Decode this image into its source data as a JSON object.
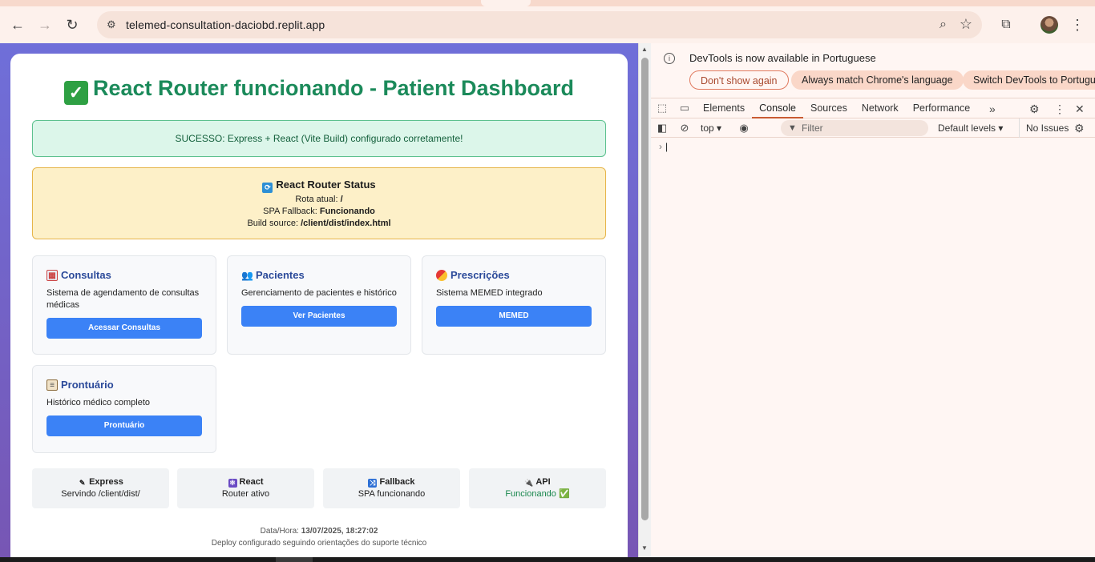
{
  "browser": {
    "url": "telemed-consultation-daciobd.replit.app"
  },
  "page": {
    "title": "React Router funcionando - Patient Dashboard",
    "success_message": "SUCESSO: Express + React (Vite Build) configurado corretamente!",
    "status": {
      "title": "React Router Status",
      "route_label": "Rota atual:",
      "route_value": "/",
      "fallback_label": "SPA Fallback:",
      "fallback_value": "Funcionando",
      "build_label": "Build source:",
      "build_value": "/client/dist/index.html"
    },
    "features": [
      {
        "title": "Consultas",
        "icon": "calendar-icon",
        "desc": "Sistema de agendamento de consultas médicas",
        "button": "Acessar Consultas"
      },
      {
        "title": "Pacientes",
        "icon": "people-icon",
        "desc": "Gerenciamento de pacientes e histórico",
        "button": "Ver Pacientes"
      },
      {
        "title": "Prescrições",
        "icon": "pill-icon",
        "desc": "Sistema MEMED integrado",
        "button": "MEMED"
      },
      {
        "title": "Prontuário",
        "icon": "clipboard-icon",
        "desc": "Histórico médico completo",
        "button": "Prontuário"
      }
    ],
    "tech": [
      {
        "title": "Express",
        "icon": "pencil-icon",
        "value": "Servindo /client/dist/"
      },
      {
        "title": "React",
        "icon": "atom-icon",
        "value": "Router ativo"
      },
      {
        "title": "Fallback",
        "icon": "shuffle-icon",
        "value": "SPA funcionando"
      },
      {
        "title": "API",
        "icon": "plug-icon",
        "value": "Funcionando ✅"
      }
    ],
    "footer": {
      "datetime_label": "Data/Hora:",
      "datetime_value": "13/07/2025, 18:27:02",
      "note": "Deploy configurado seguindo orientações do suporte técnico"
    }
  },
  "devtools": {
    "info_text": "DevTools is now available in Portuguese",
    "pill_dismiss": "Don't show again",
    "pill_match": "Always match Chrome's language",
    "pill_switch": "Switch DevTools to Portuguese",
    "tabs": [
      "Elements",
      "Console",
      "Sources",
      "Network",
      "Performance"
    ],
    "active_tab": "Console",
    "context": "top",
    "filter_placeholder": "Filter",
    "levels": "Default levels",
    "issues": "No Issues"
  },
  "colors": {
    "accent_green": "#1b8a5a",
    "button_blue": "#3b82f6",
    "viewport_gradient_top": "#6f6fd9"
  }
}
